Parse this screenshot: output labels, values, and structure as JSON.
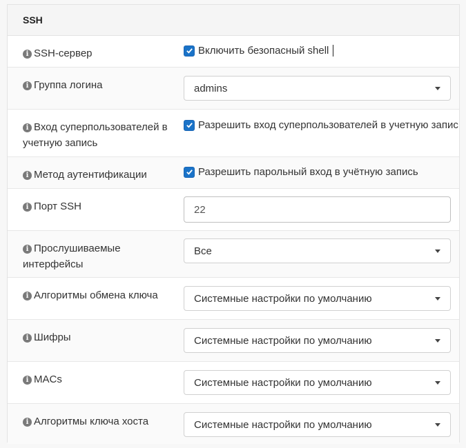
{
  "section": {
    "title": "SSH"
  },
  "rows": {
    "ssh_server": {
      "label": "SSH-сервер",
      "checkbox_label": "Включить безопасный shell",
      "checked": true
    },
    "login_group": {
      "label": "Группа логина",
      "value": "admins"
    },
    "root_login": {
      "label_line1": "Вход суперпользователей в",
      "label_line2": "учетную запись",
      "checkbox_label": "Разрешить вход суперпользователей в учетную запис",
      "checked": true
    },
    "auth_method": {
      "label": "Метод аутентификации",
      "checkbox_label": "Разрешить парольный вход в учётную запись",
      "checked": true
    },
    "ssh_port": {
      "label": "Порт SSH",
      "value": "22"
    },
    "listen_interfaces": {
      "label_line1": "Прослушиваемые",
      "label_line2": "интерфейсы",
      "value": "Все"
    },
    "kex_algorithms": {
      "label": "Алгоритмы обмена ключа",
      "value": "Системные настройки по умолчанию"
    },
    "ciphers": {
      "label": "Шифры",
      "value": "Системные настройки по умолчанию"
    },
    "macs": {
      "label": "MACs",
      "value": "Системные настройки по умолчанию"
    },
    "host_key_algorithms": {
      "label": "Алгоритмы ключа хоста",
      "value": "Системные настройки по умолчанию"
    }
  },
  "icons": {
    "info": "info-circle-icon",
    "checkbox": "checkmark-icon",
    "dropdown": "caret-down-icon"
  },
  "colors": {
    "accent": "#1a73c8"
  }
}
